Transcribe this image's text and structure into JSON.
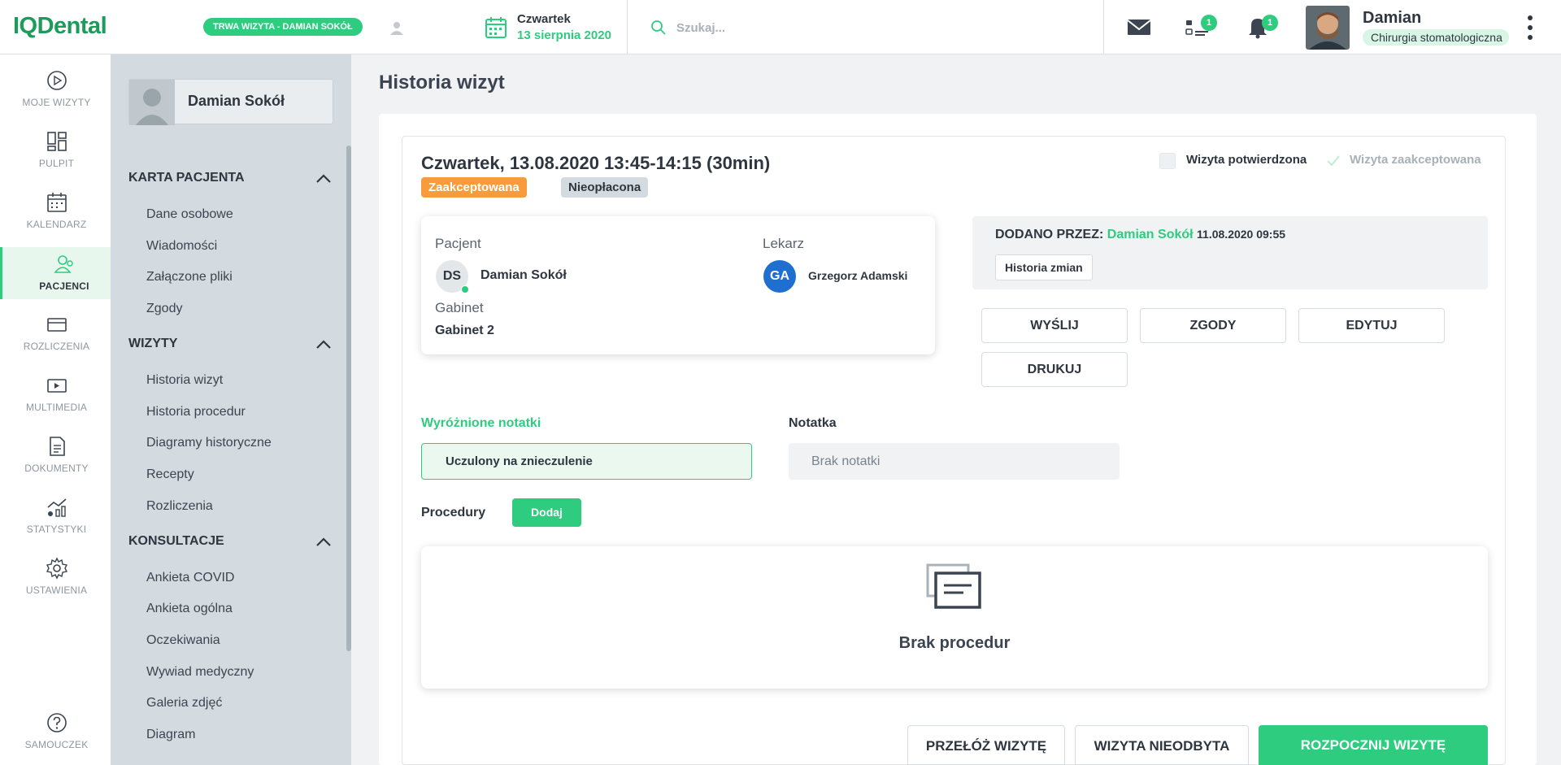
{
  "app": {
    "logo": "IQDental"
  },
  "topbar": {
    "visit_pill": "TRWA WIZYTA - DAMIAN SOKÓŁ",
    "date_day": "Czwartek",
    "date_full": "13 sierpnia 2020",
    "search_placeholder": "Szukaj...",
    "tasks_badge": "1",
    "notifications_badge": "1",
    "user_name": "Damian",
    "user_role": "Chirurgia stomatologiczna"
  },
  "iconnav": [
    {
      "label": "MOJE WIZYTY",
      "icon": "play-circle-icon"
    },
    {
      "label": "PULPIT",
      "icon": "dashboard-icon"
    },
    {
      "label": "KALENDARZ",
      "icon": "calendar-icon"
    },
    {
      "label": "PACJENCI",
      "icon": "patients-icon",
      "active": true
    },
    {
      "label": "ROZLICZENIA",
      "icon": "card-icon"
    },
    {
      "label": "MULTIMEDIA",
      "icon": "media-icon"
    },
    {
      "label": "DOKUMENTY",
      "icon": "document-icon"
    },
    {
      "label": "STATYSTYKI",
      "icon": "stats-icon"
    },
    {
      "label": "USTAWIENIA",
      "icon": "gear-icon"
    },
    {
      "label": "SAMOUCZEK",
      "icon": "help-icon"
    }
  ],
  "sidebar": {
    "patient_name": "Damian Sokół",
    "sections": [
      {
        "title": "KARTA PACJENTA",
        "items": [
          "Dane osobowe",
          "Wiadomości",
          "Załączone pliki",
          "Zgody"
        ]
      },
      {
        "title": "WIZYTY",
        "items": [
          "Historia wizyt",
          "Historia procedur",
          "Diagramy historyczne",
          "Recepty",
          "Rozliczenia"
        ]
      },
      {
        "title": "KONSULTACJE",
        "items": [
          "Ankieta COVID",
          "Ankieta ogólna",
          "Oczekiwania",
          "Wywiad medyczny",
          "Galeria zdjęć",
          "Diagram"
        ]
      }
    ]
  },
  "main": {
    "page_title": "Historia wizyt",
    "visit": {
      "title": "Czwartek, 13.08.2020 13:45-14:15 (30min)",
      "status_accepted": "Zaakceptowana",
      "status_payment": "Nieopłacona",
      "confirmed_label": "Wizyta potwierdzona",
      "accepted_label": "Wizyta zaakceptowana",
      "patient_label": "Pacjent",
      "patient_initials": "DS",
      "patient_name": "Damian Sokół",
      "doctor_label": "Lekarz",
      "doctor_initials": "GA",
      "doctor_name": "Grzegorz Adamski",
      "office_label": "Gabinet",
      "office_value": "Gabinet 2",
      "added_by_label": "DODANO PRZEZ:",
      "added_by_name": "Damian Sokół",
      "added_at": "11.08.2020 09:55",
      "history_button": "Historia zmian",
      "actions": [
        "WYŚLIJ",
        "ZGODY",
        "EDYTUJ",
        "DRUKUJ"
      ],
      "highlighted_notes_title": "Wyróżnione notatki",
      "highlighted_note": "Uczulony na znieczulenie",
      "note_title": "Notatka",
      "note_value": "Brak notatki",
      "procedures_label": "Procedury",
      "add_button": "Dodaj",
      "empty_procedures": "Brak procedur",
      "footer_buttons": [
        "PRZEŁÓŻ WIZYTĘ",
        "WIZYTA NIEODBYTA",
        "ROZPOCZNIJ WIZYTĘ"
      ]
    }
  },
  "colors": {
    "brand": "#1d9b5a",
    "accent": "#2ecc7f",
    "accepted": "#f89b3a",
    "doctor_avatar": "#1f6fd1"
  }
}
